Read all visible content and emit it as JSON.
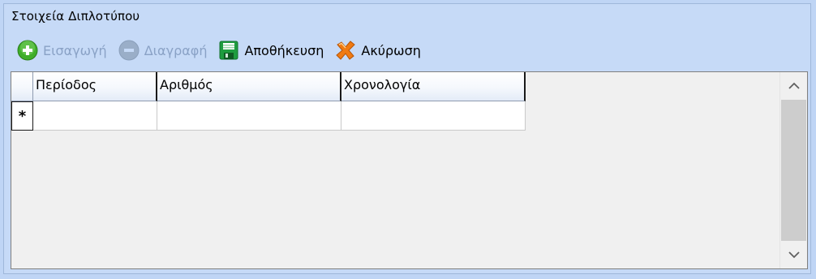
{
  "panel": {
    "title": "Στοιχεία Διπλοτύπου"
  },
  "toolbar": {
    "insert_label": "Εισαγωγή",
    "delete_label": "Διαγραφή",
    "save_label": "Αποθήκευση",
    "cancel_label": "Ακύρωση"
  },
  "grid": {
    "columns": [
      {
        "label": "Περίοδος"
      },
      {
        "label": "Αριθμός"
      },
      {
        "label": "Χρονολογία"
      }
    ],
    "new_row_marker": "*"
  },
  "colors": {
    "insert_green": "#3fae2a",
    "disabled_gray": "#9aaec8",
    "save_green": "#1e9d3f",
    "cancel_orange": "#f07a12",
    "panel_bg": "#c6daf7"
  },
  "icons": {
    "insert": "plus-circle-icon",
    "delete": "minus-circle-icon",
    "save": "floppy-disk-icon",
    "cancel": "cross-icon",
    "scroll_up": "chevron-up-icon",
    "scroll_down": "chevron-down-icon"
  }
}
